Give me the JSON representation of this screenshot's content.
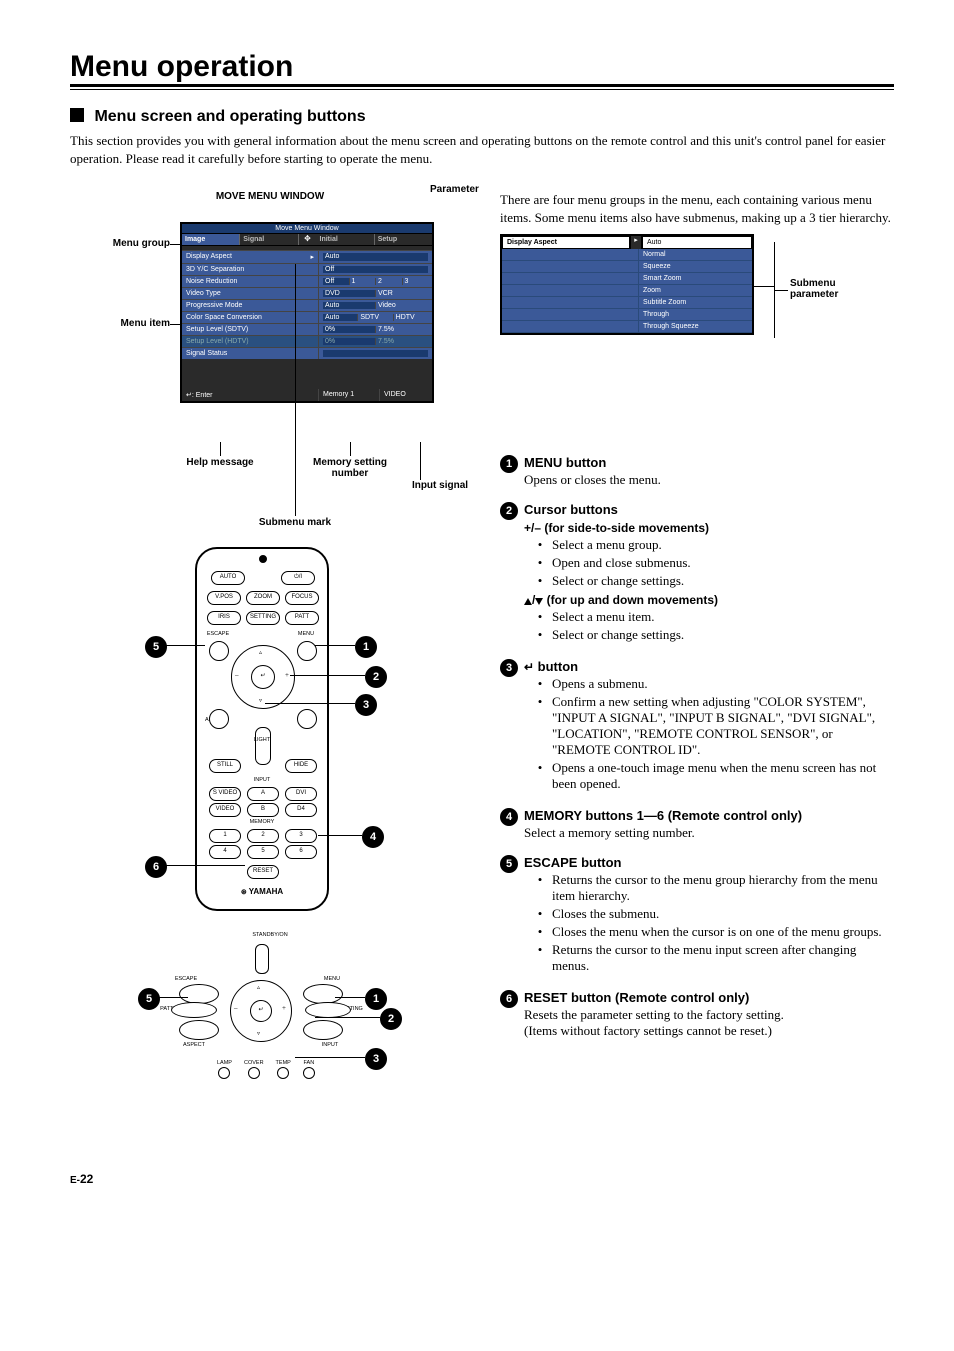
{
  "page_title": "Menu operation",
  "subheading": "Menu screen and operating buttons",
  "intro": "This section provides you with general information about the menu screen and operating buttons on the remote control and this unit's control panel for easier operation. Please read it carefully before starting to operate the menu.",
  "move_menu_heading": "MOVE MENU WINDOW",
  "right_intro": "There are four menu groups in the menu, each containing various menu items. Some menu items also have submenus, making up a 3 tier hierarchy.",
  "labels": {
    "menu_group": "Menu group",
    "menu_item": "Menu item",
    "parameter": "Parameter",
    "help_message": "Help message",
    "memory_setting_number": "Memory setting number",
    "input_signal": "Input signal",
    "submenu_mark": "Submenu mark",
    "submenu_parameter": "Submenu parameter"
  },
  "menu_window": {
    "titlebar": "Move Menu Window",
    "tabs": [
      "Image",
      "Signal",
      "Initial",
      "Setup"
    ],
    "rows": [
      {
        "k": "Display Aspect",
        "vals": [
          "Auto"
        ],
        "mark": true
      },
      {
        "k": "3D Y/C Separation",
        "vals": [
          "Off"
        ]
      },
      {
        "k": "Noise Reduction",
        "vals": [
          "Off",
          "1",
          "2",
          "3"
        ]
      },
      {
        "k": "Video Type",
        "vals": [
          "DVD",
          "VCR"
        ]
      },
      {
        "k": "Progressive Mode",
        "vals": [
          "Auto",
          "Video"
        ]
      },
      {
        "k": "Color Space Conversion",
        "vals": [
          "Auto",
          "SDTV",
          "HDTV"
        ]
      },
      {
        "k": "Setup Level (SDTV)",
        "vals": [
          "0%",
          "7.5%"
        ]
      },
      {
        "k": "Setup Level (HDTV)",
        "vals": [
          "0%",
          "7.5%"
        ],
        "dim": true
      },
      {
        "k": "Signal Status",
        "vals": [
          ""
        ]
      }
    ],
    "footer": {
      "help": "↵: Enter",
      "memory": "Memory 1",
      "input": "VIDEO"
    }
  },
  "submenu_window": {
    "head_k": "Display Aspect",
    "head_v": "Auto",
    "items": [
      "Normal",
      "Squeeze",
      "Smart Zoom",
      "Zoom",
      "Subtitle Zoom",
      "Through",
      "Through Squeeze"
    ]
  },
  "remote_text": {
    "auto": "AUTO",
    "power": "⏻/I",
    "vpos": "V.POS",
    "zoom": "ZOOM",
    "focus": "FOCUS",
    "iris": "IRIS",
    "setting": "SETTING",
    "patt": "PATT",
    "escape": "ESCAPE",
    "menu": "MENU",
    "aspect": "ASPECT",
    "input": "INPUT",
    "light": "LIGHT",
    "still": "STILL",
    "hide": "HIDE",
    "input_lbl": "INPUT",
    "svideo": "S VIDEO",
    "a": "A",
    "dvi": "DVI",
    "video": "VIDEO",
    "b": "B",
    "d4": "D4",
    "memory_lbl": "MEMORY",
    "m1": "1",
    "m2": "2",
    "m3": "3",
    "m4": "4",
    "m5": "5",
    "m6": "6",
    "reset": "RESET",
    "brand": "YAMAHA"
  },
  "panel_text": {
    "standby": "STANDBY/ON",
    "escape": "ESCAPE",
    "menu": "MENU",
    "pattern": "PATTERN",
    "setting": "SETTING",
    "aspect": "ASPECT",
    "input": "INPUT",
    "lamp": "LAMP",
    "cover": "COVER",
    "temp": "TEMP",
    "fan": "FAN"
  },
  "desc": [
    {
      "n": "1",
      "title": "MENU button",
      "body": "Opens or closes the menu."
    },
    {
      "n": "2",
      "title": "Cursor buttons",
      "sub1": "+/– (for side-to-side movements)",
      "bul1": [
        "Select a menu group.",
        "Open and close submenus.",
        "Select or change settings."
      ],
      "sub2_prefix": "△/▽",
      "sub2": " (for up and down movements)",
      "bul2": [
        "Select a menu item.",
        "Select or change settings."
      ]
    },
    {
      "n": "3",
      "title_glyph": "↵",
      "title": " button",
      "bul": [
        "Opens a submenu.",
        "Confirm a new setting when adjusting \"COLOR SYSTEM\", \"INPUT A SIGNAL\", \"INPUT B SIGNAL\", \"DVI SIGNAL\", \"LOCATION\", \"REMOTE CONTROL SENSOR\", or \"REMOTE CONTROL ID\".",
        "Opens a one-touch image menu when the menu screen has not been opened."
      ]
    },
    {
      "n": "4",
      "title": "MEMORY buttons 1—6 (Remote control only)",
      "body": "Select a memory setting number."
    },
    {
      "n": "5",
      "title": "ESCAPE button",
      "bul": [
        "Returns the cursor to the menu group hierarchy from the menu item hierarchy.",
        "Closes the submenu.",
        "Closes the menu when the cursor is on one of the menu groups.",
        "Returns the cursor to the menu input screen after changing menus."
      ]
    },
    {
      "n": "6",
      "title": "RESET button (Remote control only)",
      "body": "Resets the parameter setting to the factory setting.\n(Items without factory settings cannot be reset.)"
    }
  ],
  "pagenum": {
    "e": "E-",
    "n": "22"
  }
}
